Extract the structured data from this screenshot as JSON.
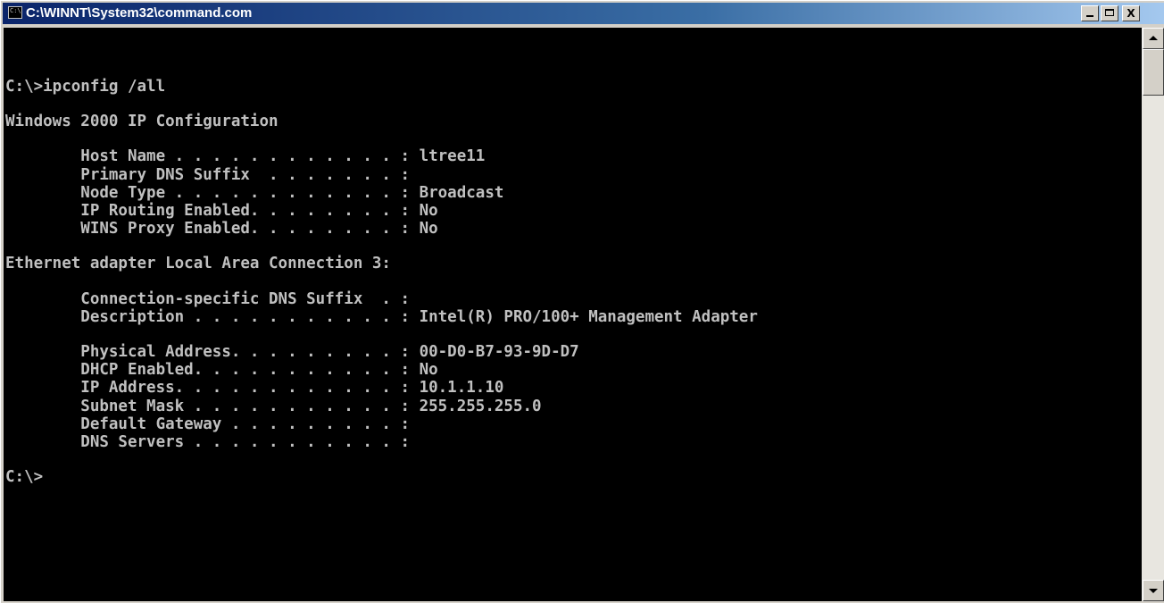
{
  "window": {
    "title": "C:\\WINNT\\System32\\command.com",
    "icon": "console-icon",
    "icon_text": "C:\\"
  },
  "title_buttons": {
    "close_label": "X"
  },
  "console": {
    "lines": [
      "C:\\>ipconfig /all",
      "",
      "Windows 2000 IP Configuration",
      "",
      "        Host Name . . . . . . . . . . . . : ltree11",
      "        Primary DNS Suffix  . . . . . . . :",
      "        Node Type . . . . . . . . . . . . : Broadcast",
      "        IP Routing Enabled. . . . . . . . : No",
      "        WINS Proxy Enabled. . . . . . . . : No",
      "",
      "Ethernet adapter Local Area Connection 3:",
      "",
      "        Connection-specific DNS Suffix  . :",
      "        Description . . . . . . . . . . . : Intel(R) PRO/100+ Management Adapter",
      "",
      "        Physical Address. . . . . . . . . : 00-D0-B7-93-9D-D7",
      "        DHCP Enabled. . . . . . . . . . . : No",
      "        IP Address. . . . . . . . . . . . : 10.1.1.10",
      "        Subnet Mask . . . . . . . . . . . : 255.255.255.0",
      "        Default Gateway . . . . . . . . . :",
      "        DNS Servers . . . . . . . . . . . :",
      "",
      "C:\\>"
    ]
  },
  "colors": {
    "titlebar_start": "#0a246a",
    "titlebar_end": "#a6caf0",
    "console_bg": "#000000",
    "console_fg": "#c0c0c0"
  }
}
